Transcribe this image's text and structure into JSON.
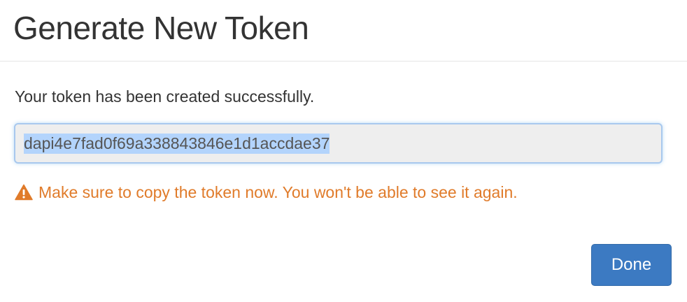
{
  "dialog": {
    "title": "Generate New Token",
    "success_message": "Your token has been created successfully.",
    "token_value": "dapi4e7fad0f69a338843846e1d1accdae37",
    "warning_icon": "warning-triangle-icon",
    "warning_message": "Make sure to copy the token now. You won't be able to see it again.",
    "done_label": "Done"
  },
  "colors": {
    "title_text": "#333333",
    "warning": "#e07b2a",
    "primary_button": "#3c7ac2",
    "input_focus_border": "#a8c8ee",
    "selection_highlight": "#b3d4fc"
  }
}
